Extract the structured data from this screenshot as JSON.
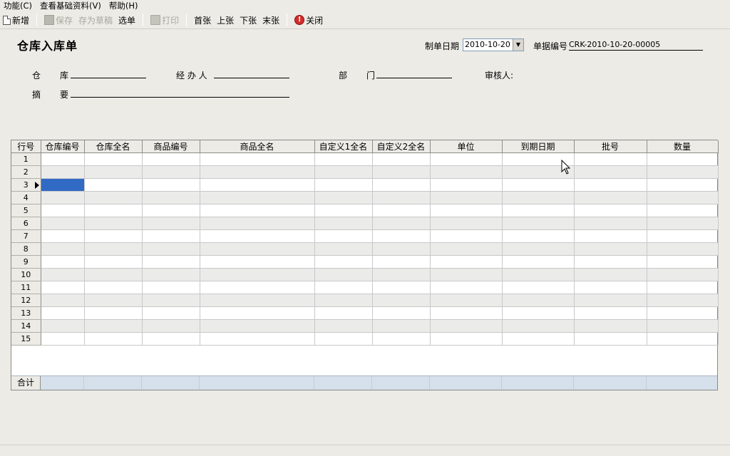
{
  "menu": [
    "功能(C)",
    "查看基础资料(V)",
    "帮助(H)"
  ],
  "toolbar": {
    "new": "新增",
    "save": "保存",
    "save_draft": "存为草稿",
    "select": "选单",
    "print": "打印",
    "first": "首张",
    "prev": "上张",
    "next": "下张",
    "last": "末张",
    "close": "关闭",
    "icons": {
      "new": "new-doc-icon",
      "save": "save-icon",
      "print": "printer-icon",
      "close": "close-icon"
    }
  },
  "form": {
    "title": "仓库入库单",
    "date_label": "制单日期",
    "date_value": "2010-10-20",
    "bill_no_label": "单据编号",
    "bill_no_value": "CRK-2010-10-20-00005",
    "warehouse_label": "仓　　库",
    "handler_label": "经 办 人",
    "dept_label": "部　　门",
    "reviewer_label": "审核人:",
    "summary_label": "摘　　要"
  },
  "grid": {
    "columns": [
      "行号",
      "仓库编号",
      "仓库全名",
      "商品编号",
      "商品全名",
      "自定义1全名",
      "自定义2全名",
      "单位",
      "到期日期",
      "批号",
      "数量"
    ],
    "rows": [
      "1",
      "2",
      "3",
      "4",
      "5",
      "6",
      "7",
      "8",
      "9",
      "10",
      "11",
      "12",
      "13",
      "14",
      "15"
    ],
    "current_row": "3",
    "total_label": "合计"
  }
}
